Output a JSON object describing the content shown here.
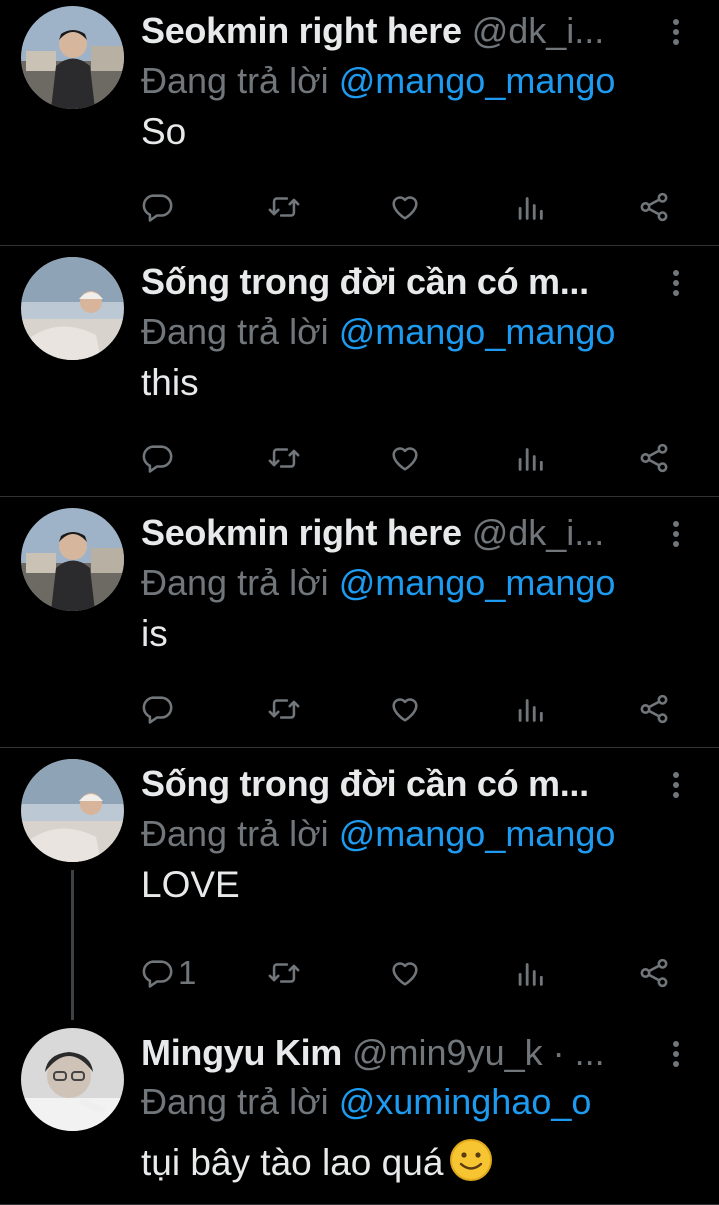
{
  "colors": {
    "background": "#000000",
    "text": "#e7e9ea",
    "muted": "#71767b",
    "accent": "#1d9bf0"
  },
  "reply_prefix": "Đang trả lời",
  "tweets": [
    {
      "name": "Seokmin right here",
      "handle": "@dk_i...",
      "reply_to": "@mango_mango",
      "text": "So",
      "reply_count": "",
      "avatar": "avatar-seokmin"
    },
    {
      "name": "Sống trong đời cần có m...",
      "handle": "",
      "reply_to": "@mango_mango",
      "text": "this",
      "reply_count": "",
      "avatar": "avatar-beach"
    },
    {
      "name": "Seokmin right here",
      "handle": "@dk_i...",
      "reply_to": "@mango_mango",
      "text": "is",
      "reply_count": "",
      "avatar": "avatar-seokmin"
    },
    {
      "name": "Sống trong đời cần có m...",
      "handle": "",
      "reply_to": "@mango_mango",
      "text": "LOVE",
      "reply_count": "1",
      "avatar": "avatar-beach"
    },
    {
      "name": "Mingyu Kim",
      "handle": "@min9yu_k · ...",
      "reply_to": "@xuminghao_o",
      "text": "tụi bây tào lao quá",
      "reply_count": "",
      "avatar": "avatar-mingyu"
    }
  ],
  "icons": [
    "reply-icon",
    "retweet-icon",
    "like-icon",
    "views-icon",
    "share-icon",
    "more-icon",
    "smile-emoji-icon"
  ]
}
